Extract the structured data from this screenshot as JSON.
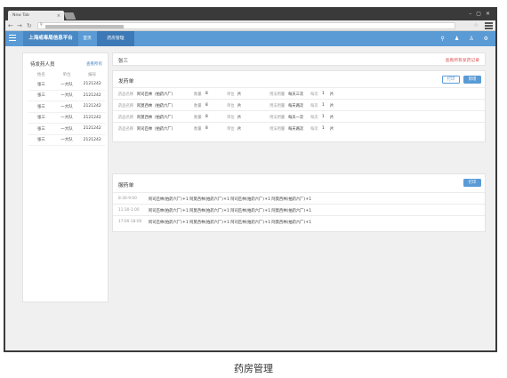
{
  "browser": {
    "tab_title": "New Tab",
    "tab_close": "×",
    "window_buttons": [
      "–",
      "▢",
      "✕"
    ]
  },
  "app": {
    "title": "上海戒毒局信息平台",
    "nav": [
      {
        "label": "首页"
      },
      {
        "label": "药房管理"
      }
    ],
    "header_icons": [
      "search-icon",
      "user-icon",
      "person-icon",
      "settings-icon"
    ]
  },
  "left_panel": {
    "title": "待发药人员",
    "link": "查看所有",
    "columns": [
      "姓名",
      "单位",
      "编号"
    ],
    "rows": [
      [
        "张三",
        "一大队",
        "2121242"
      ],
      [
        "张三",
        "一大队",
        "2121242"
      ],
      [
        "张三",
        "一大队",
        "2121242"
      ],
      [
        "张三",
        "一大队",
        "2121242"
      ],
      [
        "张三",
        "一大队",
        "2121242"
      ],
      [
        "张三",
        "一大队",
        "2121242"
      ]
    ]
  },
  "patient": {
    "name": "张三",
    "link": "查看所有发药记录"
  },
  "dispense": {
    "title": "发药单",
    "btn_print": "打印",
    "btn_add": "新增",
    "labels": {
      "drug": "药品名称",
      "qty": "数量",
      "unit": "单位",
      "usage": "用法用量",
      "per": "每次"
    },
    "rows": [
      {
        "drug": "阿司匹林（拍药六厂）",
        "qty": "8",
        "unit": "片",
        "usage": "每天三次",
        "per": "1",
        "per_unit": "片"
      },
      {
        "drug": "阿莫西林（拍药六厂）",
        "qty": "8",
        "unit": "片",
        "usage": "每天两次",
        "per": "1",
        "per_unit": "片"
      },
      {
        "drug": "阿莫西林（拍药六厂）",
        "qty": "8",
        "unit": "片",
        "usage": "每天一次",
        "per": "1",
        "per_unit": "片"
      },
      {
        "drug": "阿司匹林（拍药六厂）",
        "qty": "8",
        "unit": "片",
        "usage": "每天两次",
        "per": "1",
        "per_unit": "片"
      }
    ]
  },
  "taken": {
    "title": "服药单",
    "btn_print": "打印",
    "rows": [
      {
        "time": "8:30-9:00",
        "meds": "阿司匹林(拍药六厂)＊1  阿莫西林(拍药六厂)＊1  阿司匹林(拍药六厂)＊1  阿莫西林(拍药六厂)＊1"
      },
      {
        "time": "11:30-1:00",
        "meds": "阿司匹林(拍药六厂)＊1  阿莫西林(拍药六厂)＊1  阿司匹林(拍药六厂)＊1  阿莫西林(拍药六厂)＊1"
      },
      {
        "time": "17:00-18:00",
        "meds": "阿司匹林(拍药六厂)＊1  阿莫西林(拍药六厂)＊1  阿司匹林(拍药六厂)＊1  阿莫西林(拍药六厂)＊1"
      }
    ]
  },
  "caption": "药房管理",
  "colors": {
    "brand": "#5a9bd5",
    "alert": "#e05353"
  }
}
